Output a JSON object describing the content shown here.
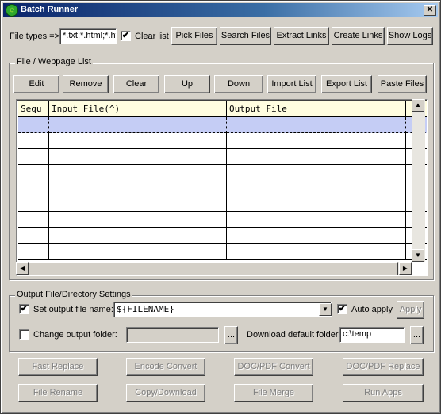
{
  "window": {
    "title": "Batch Runner",
    "close_glyph": "✕"
  },
  "toolbar": {
    "file_types_label": "File types =>",
    "file_types_value": "*.txt;*.html;*.ht",
    "clear_list_label": "Clear list",
    "clear_list_checked": true,
    "pick_files": "Pick Files",
    "search_files": "Search Files",
    "extract_links": "Extract Links",
    "create_links": "Create Links",
    "show_logs": "Show Logs"
  },
  "file_list": {
    "group_title": "File / Webpage List",
    "buttons": [
      "Edit",
      "Remove",
      "Clear",
      "Up",
      "Down",
      "Import List",
      "Export List",
      "Paste Files"
    ],
    "columns": [
      "Sequ",
      "Input File(^)",
      "Output File"
    ],
    "rows": [
      [
        "",
        "",
        ""
      ],
      [
        "",
        "",
        ""
      ],
      [
        "",
        "",
        ""
      ],
      [
        "",
        "",
        ""
      ],
      [
        "",
        "",
        ""
      ],
      [
        "",
        "",
        ""
      ],
      [
        "",
        "",
        ""
      ],
      [
        "",
        "",
        ""
      ],
      [
        "",
        "",
        ""
      ]
    ]
  },
  "output": {
    "group_title": "Output File/Directory Settings",
    "set_output_label": "Set output file name:",
    "set_output_checked": true,
    "output_name_value": "${FILENAME}",
    "auto_apply_label": "Auto apply",
    "auto_apply_checked": true,
    "apply_label": "Apply",
    "change_folder_label": "Change output folder:",
    "change_folder_checked": false,
    "browse_label": "...",
    "download_folder_label": "Download default folder:",
    "download_folder_value": "c:\\temp",
    "browse2_label": "..."
  },
  "actions": {
    "row1": [
      "Fast Replace",
      "Encode Convert",
      "DOC/PDF Convert",
      "DOC/PDF Replace"
    ],
    "row2": [
      "File Rename",
      "Copy/Download",
      "File Merge",
      "Run Apps"
    ]
  },
  "icons": {
    "app": "app-icon",
    "check_glyph": "✔",
    "arrow_up": "▲",
    "arrow_down": "▼",
    "arrow_left": "◀",
    "arrow_right": "▶"
  },
  "colors": {
    "title_start": "#0a246a",
    "title_end": "#a6caf0",
    "header_bg": "#fffde0",
    "selected_row": "#c5cdf5"
  }
}
